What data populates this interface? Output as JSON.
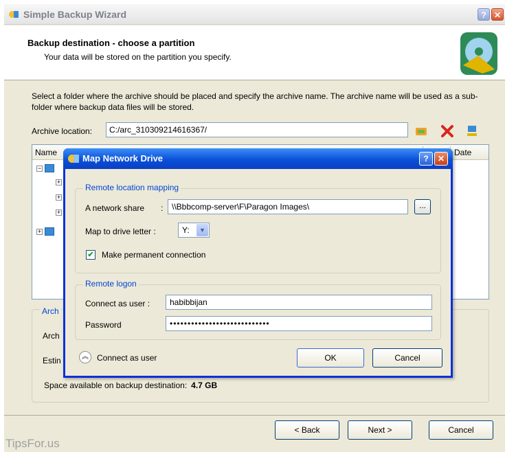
{
  "window": {
    "title": "Simple Backup Wizard",
    "help_glyph": "?",
    "close_glyph": "✕"
  },
  "header": {
    "title": "Backup destination - choose a partition",
    "subtitle": "Your data will be stored on the partition you specify."
  },
  "instructions": "Select a folder where the archive should be placed and specify the archive name. The archive name will be used as a sub-folder where backup data files will be stored.",
  "archive_location": {
    "label": "Archive location:",
    "value": "C:/arc_310309214616367/"
  },
  "tree": {
    "col_name": "Name",
    "col_date": "Date"
  },
  "archive_info": {
    "legend": "Arch",
    "line1": "Arch",
    "line2": "Estin",
    "space_label": "Space available on backup destination:",
    "space_value": "4.7 GB"
  },
  "nav": {
    "back": "< Back",
    "next": "Next >",
    "cancel": "Cancel"
  },
  "watermark": "TipsFor.us",
  "dialog": {
    "title": "Map Network Drive",
    "help_glyph": "?",
    "close_glyph": "✕",
    "remote_mapping": {
      "legend": "Remote location mapping",
      "share_label": "A network share",
      "share_colon": ":",
      "share_value": "\\\\Bbbcomp-server\\F\\Paragon Images\\",
      "browse_label": "...",
      "drive_label": "Map to drive letter :",
      "drive_value": "Y:",
      "permanent_label": "Make permanent connection",
      "permanent_checked": true
    },
    "remote_logon": {
      "legend": "Remote logon",
      "user_label": "Connect as user :",
      "user_value": "habibbijan",
      "password_label": "Password",
      "password_value": "••••••••••••••••••••••••••••"
    },
    "toggle_label": "Connect as user",
    "ok": "OK",
    "cancel": "Cancel"
  },
  "colors": {
    "accent_blue": "#0046d5",
    "xp_title_blue": "#0a50d8",
    "window_bg": "#ece9d8"
  }
}
